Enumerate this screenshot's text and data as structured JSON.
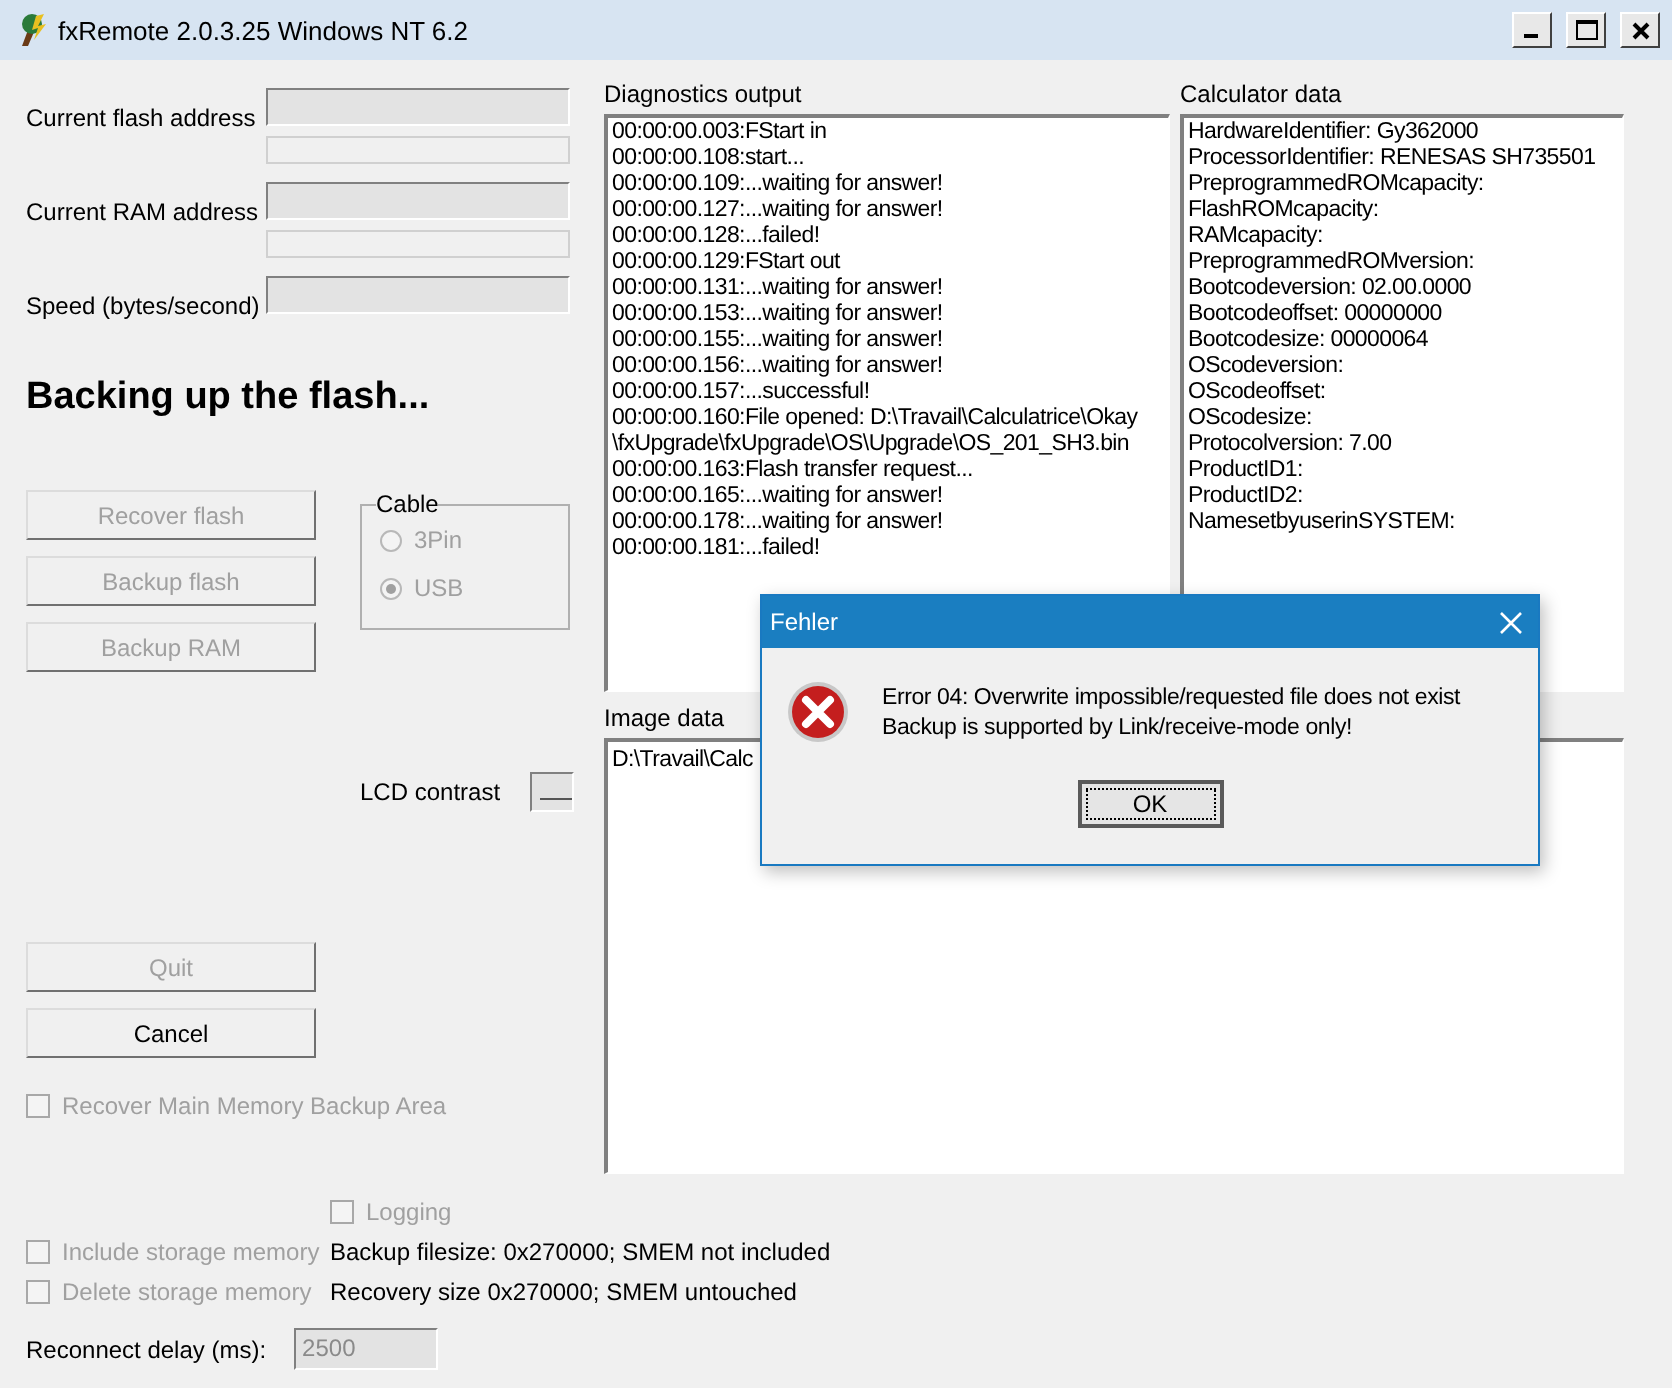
{
  "window": {
    "title": "fxRemote 2.0.3.25 Windows NT 6.2"
  },
  "fields": [
    {
      "label": "Current flash address",
      "kind": "address",
      "level": 0
    },
    {
      "label": "Current RAM address",
      "kind": "address",
      "level": 0
    },
    {
      "label": "Speed (bytes/second)",
      "kind": "plain"
    }
  ],
  "status": "Backing up the flash...",
  "buttons": [
    {
      "label": "Recover flash",
      "disabled": true
    },
    {
      "label": "Backup flash",
      "disabled": true
    },
    {
      "label": "Backup RAM",
      "disabled": true
    }
  ],
  "cable": {
    "title": "Cable",
    "options": [
      {
        "label": "3Pin",
        "selected": false,
        "disabled": true
      },
      {
        "label": "USB",
        "selected": true,
        "disabled": true
      }
    ]
  },
  "lcd_contrast": {
    "label": "LCD contrast"
  },
  "actions": [
    {
      "label": "Quit",
      "disabled": true
    },
    {
      "label": "Cancel",
      "disabled": false
    }
  ],
  "recover_main_memory": {
    "label": "Recover Main Memory Backup Area",
    "checked": false,
    "disabled": true
  },
  "diagnostics": {
    "title": "Diagnostics output",
    "lines": [
      "00:00:00.003:FStart in",
      "00:00:00.108:start...",
      "00:00:00.109:...waiting for answer!",
      "00:00:00.127:...waiting for answer!",
      "00:00:00.128:...failed!",
      "00:00:00.129:FStart out",
      "00:00:00.131:...waiting for answer!",
      "00:00:00.153:...waiting for answer!",
      "00:00:00.155:...waiting for answer!",
      "00:00:00.156:...waiting for answer!",
      "00:00:00.157:...successful!",
      "00:00:00.160:File opened: D:\\Travail\\Calculatrice\\Okay",
      "\\fxUpgrade\\fxUpgrade\\OS\\Upgrade\\OS_201_SH3.bin",
      "00:00:00.163:Flash transfer request...",
      "00:00:00.165:...waiting for answer!",
      "00:00:00.178:...waiting for answer!",
      "00:00:00.181:...failed!"
    ]
  },
  "calculator_data": {
    "title": "Calculator data",
    "lines": [
      "HardwareIdentifier: Gy362000",
      "ProcessorIdentifier: RENESAS SH735501",
      "PreprogrammedROMcapacity:",
      "FlashROMcapacity:",
      "RAMcapacity:",
      "PreprogrammedROMversion:",
      "Bootcodeversion: 02.00.0000",
      "Bootcodeoffset: 00000000",
      "Bootcodesize: 00000064",
      "OScodeversion:",
      "OScodeoffset:",
      "OScodesize:",
      "Protocolversion: 7.00",
      "ProductID1:",
      "ProductID2:",
      "NamesetbyuserinSYSTEM:"
    ]
  },
  "image_data": {
    "title": "Image data",
    "text": "D:\\Travail\\Calc"
  },
  "logging": {
    "label": "Logging",
    "checked": false,
    "disabled": true
  },
  "storage_options": [
    {
      "label": "Include storage memory",
      "checked": false,
      "disabled": true
    },
    {
      "label": "Delete storage memory",
      "checked": false,
      "disabled": true
    }
  ],
  "size_info": [
    "Backup filesize: 0x270000; SMEM not included",
    "Recovery size 0x270000; SMEM untouched"
  ],
  "reconnect_delay": {
    "label": "Reconnect delay (ms):",
    "value": "2500",
    "disabled": true
  },
  "dialog": {
    "title": "Fehler",
    "message_lines": [
      "Error 04: Overwrite impossible/requested file does not exist",
      "Backup is supported by Link/receive-mode only!"
    ],
    "button": "OK"
  }
}
